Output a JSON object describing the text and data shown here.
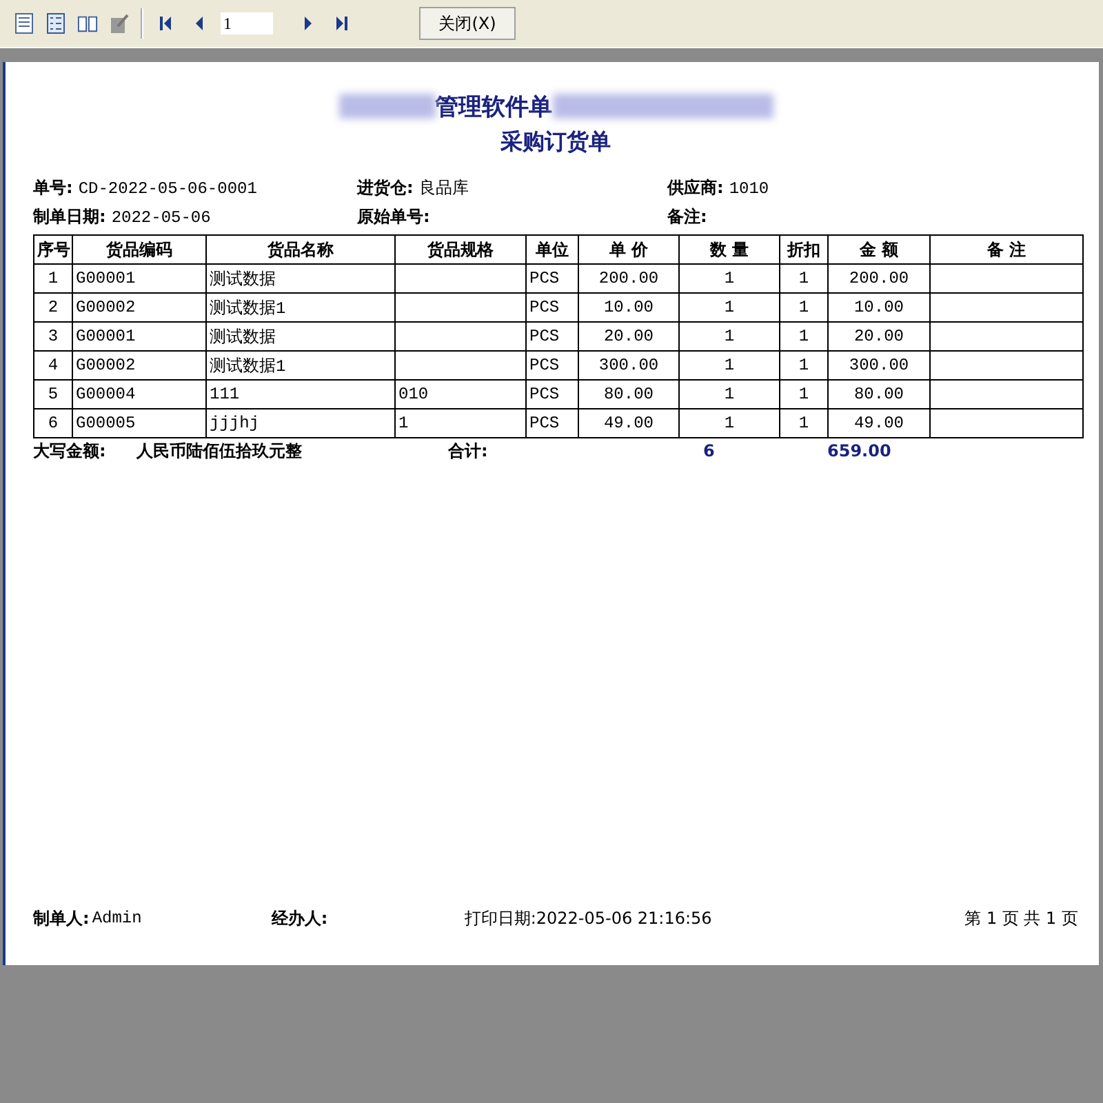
{
  "toolbar": {
    "page_field": {
      "value": "1"
    },
    "close_button": "关闭(X)"
  },
  "report": {
    "company_title": "管理软件单",
    "title": "采购订货单",
    "fields": [
      [
        {
          "label": "单号:",
          "value": "CD-2022-05-06-0001"
        },
        {
          "label": "进货仓:",
          "value": "良品库"
        },
        {
          "label": "供应商:",
          "value": "1010"
        }
      ],
      [
        {
          "label": "制单日期:",
          "value": "2022-05-06"
        },
        {
          "label": "原始单号:"
        },
        {
          "label": "备注:"
        }
      ]
    ],
    "table": {
      "columns": [
        "序号",
        "货品编码",
        "货品名称",
        "货品规格",
        "单位",
        "单 价",
        "数 量",
        "折扣",
        "金 额",
        "备  注"
      ],
      "rows": [
        [
          "1",
          "G00001",
          "测试数据",
          "",
          "PCS",
          "200.00",
          "1",
          "1",
          "200.00",
          ""
        ],
        [
          "2",
          "G00002",
          "测试数据1",
          "",
          "PCS",
          "10.00",
          "1",
          "1",
          "10.00",
          ""
        ],
        [
          "3",
          "G00001",
          "测试数据",
          "",
          "PCS",
          "20.00",
          "1",
          "1",
          "20.00",
          ""
        ],
        [
          "4",
          "G00002",
          "测试数据1",
          "",
          "PCS",
          "300.00",
          "1",
          "1",
          "300.00",
          ""
        ],
        [
          "5",
          "G00004",
          "111",
          "010",
          "PCS",
          "80.00",
          "1",
          "1",
          "80.00",
          ""
        ],
        [
          "6",
          "G00005",
          "jjjhj",
          "1",
          "PCS",
          "49.00",
          "1",
          "1",
          "49.00",
          ""
        ]
      ]
    },
    "amount_in_words": {
      "label": "大写金额:",
      "value": "人民币陆佰伍拾玖元整"
    },
    "total": {
      "label": "合计:",
      "quantity": "6",
      "amount": "659.00"
    },
    "footer": {
      "maker_label": "制单人:",
      "maker": "Admin",
      "handler_label": "经办人:",
      "print_date": "打印日期:2022-05-06 21:16:56",
      "page_info": "第 1 页 共 1 页"
    }
  }
}
